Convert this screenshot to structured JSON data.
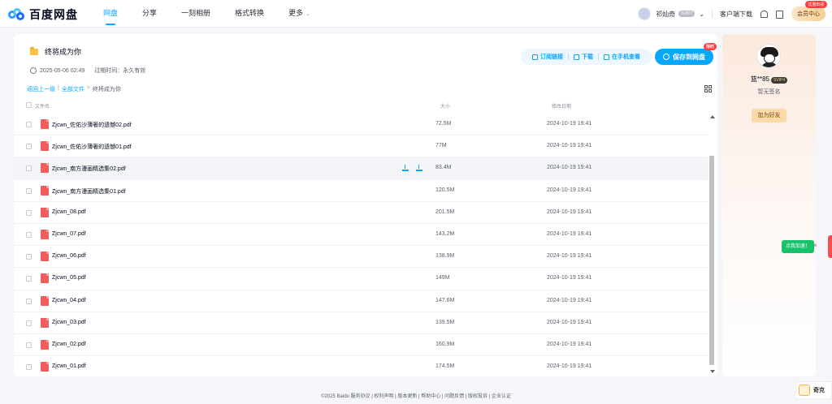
{
  "brand": {
    "name": "百度网盘"
  },
  "nav": [
    {
      "label": "网盘",
      "active": true
    },
    {
      "label": "分享",
      "active": false
    },
    {
      "label": "一刻相册",
      "active": false
    },
    {
      "label": "格式转换",
      "active": false
    },
    {
      "label": "更多",
      "active": false
    }
  ],
  "user": {
    "name": "祁灿奇",
    "badge": "SVIP7",
    "client_download": "客户端下载",
    "vip_button": "会员中心",
    "vip_tag": "优惠85折"
  },
  "share": {
    "title": "终将成为你",
    "created": "2025-05-06 02:49",
    "expiry_label": "过期时间：永久有效",
    "actions": {
      "subscribe": "订阅链接",
      "download": "下载",
      "phone_view": "在手机查看",
      "save": "保存到网盘",
      "save_tag": "限时"
    }
  },
  "breadcrumb": {
    "back": "返回上一级",
    "all": "全部文件",
    "current": "终将成为你"
  },
  "columns": {
    "name": "文件名",
    "size": "大小",
    "date": "修改日期"
  },
  "files": [
    {
      "name": "Zjcwn_佐佑沙薄奢的遗憾02.pdf",
      "size": "72.5M",
      "date": "2024-10-19 19:41"
    },
    {
      "name": "Zjcwn_佐佑沙薄奢的遗憾01.pdf",
      "size": "77M",
      "date": "2024-10-19 19:41"
    },
    {
      "name": "Zjcwn_南方漫画精选集02.pdf",
      "size": "83.4M",
      "date": "2024-10-19 19:41"
    },
    {
      "name": "Zjcwn_南方漫画精选集01.pdf",
      "size": "120.5M",
      "date": "2024-10-19 19:41"
    },
    {
      "name": "Zjcwn_08.pdf",
      "size": "201.5M",
      "date": "2024-10-19 19:41"
    },
    {
      "name": "Zjcwn_07.pdf",
      "size": "143.2M",
      "date": "2024-10-19 19:41"
    },
    {
      "name": "Zjcwn_06.pdf",
      "size": "138.9M",
      "date": "2024-10-19 19:41"
    },
    {
      "name": "Zjcwn_05.pdf",
      "size": "149M",
      "date": "2024-10-19 19:41"
    },
    {
      "name": "Zjcwn_04.pdf",
      "size": "147.6M",
      "date": "2024-10-19 19:41"
    },
    {
      "name": "Zjcwn_03.pdf",
      "size": "139.5M",
      "date": "2024-10-19 19:41"
    },
    {
      "name": "Zjcwn_02.pdf",
      "size": "160.9M",
      "date": "2024-10-19 19:41"
    },
    {
      "name": "Zjcwn_01.pdf",
      "size": "174.5M",
      "date": "2024-10-19 19:41"
    }
  ],
  "sharer": {
    "name": "篮**85",
    "badge": "SVIP4",
    "signature": "暂无签名",
    "add_friend": "加为好友"
  },
  "float": {
    "tip": "点我加速！",
    "close": "×",
    "cloud_label": "奇克"
  },
  "footer": "©2025 Baidu  服务协议 | 权利声明 | 版本更新 | 帮助中心 | 问题反馈 | 版权投诉 | 企业认证"
}
